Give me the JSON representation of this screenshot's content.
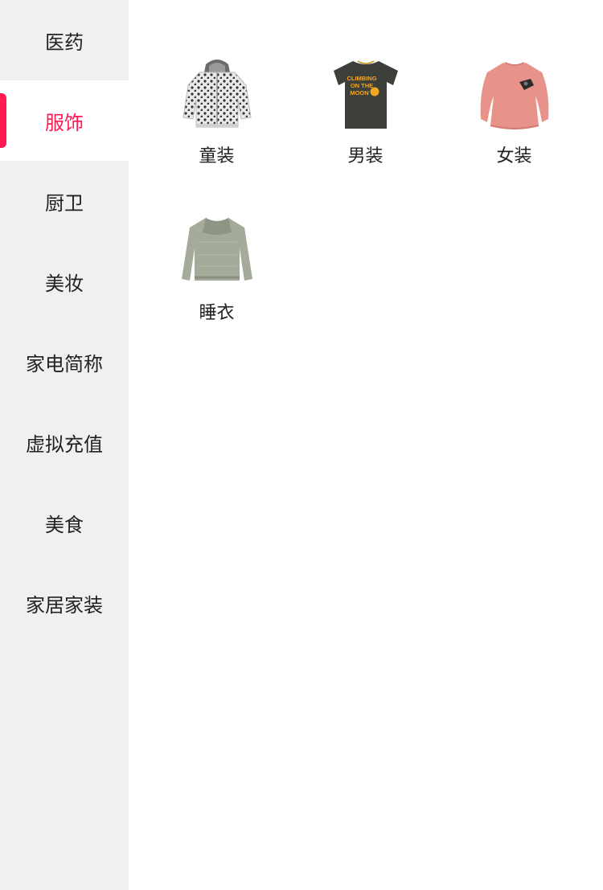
{
  "sidebar": {
    "items": [
      {
        "label": "医药"
      },
      {
        "label": "服饰"
      },
      {
        "label": "厨卫"
      },
      {
        "label": "美妆"
      },
      {
        "label": "家电简称"
      },
      {
        "label": "虚拟充值"
      },
      {
        "label": "美食"
      },
      {
        "label": "家居家装"
      }
    ],
    "selected_index": 1
  },
  "content": {
    "items": [
      {
        "label": "童装",
        "icon": "kids-hoodie-icon"
      },
      {
        "label": "男装",
        "icon": "mens-tshirt-icon",
        "shirt_text": [
          "CLIMBING",
          "ON THE",
          "MOON"
        ]
      },
      {
        "label": "女装",
        "icon": "womens-sweater-icon"
      },
      {
        "label": "睡衣",
        "icon": "pajama-sweater-icon"
      }
    ]
  },
  "colors": {
    "accent": "#ff1a4f",
    "sidebar_bg": "#f0f0f0",
    "text": "#222222"
  }
}
